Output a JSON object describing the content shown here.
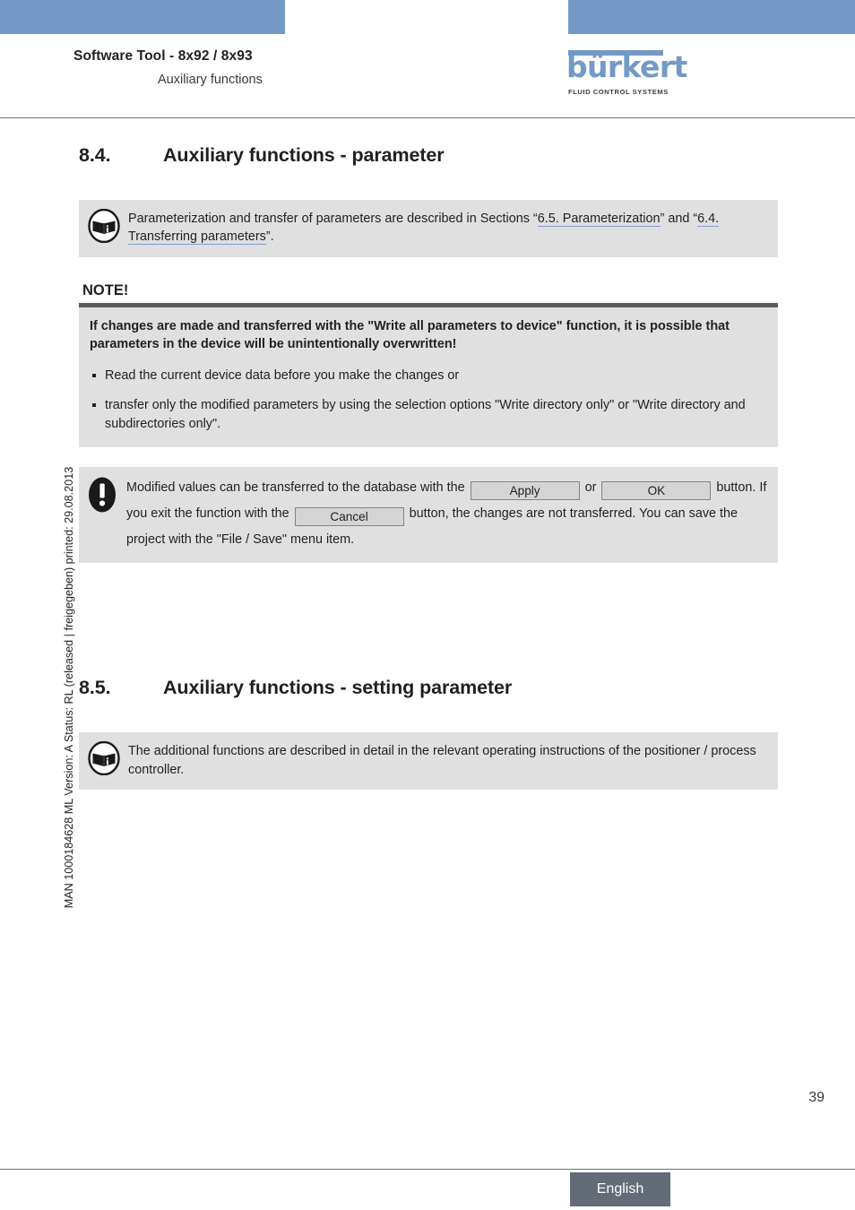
{
  "header": {
    "title": "Software Tool - 8x92 / 8x93",
    "subtitle": "Auxiliary functions",
    "logo_word": "bürkert",
    "logo_tagline": "FLUID CONTROL SYSTEMS"
  },
  "side_imprint": "MAN 1000184628  ML  Version: A  Status: RL (released | freigegeben)  printed: 29.08.2013",
  "sections": {
    "s84": {
      "number": "8.4.",
      "title": "Auxiliary functions - parameter"
    },
    "s85": {
      "number": "8.5.",
      "title": "Auxiliary functions - setting parameter"
    }
  },
  "info_box_1": {
    "icon": "manual-icon",
    "text_part_1": "Parameterization and transfer of parameters are described in Sections “",
    "link_1": "6.5. Parameterization",
    "text_part_2": "” and “",
    "link_2a": "6.4. ",
    "link_2b": "Transferring parameters",
    "text_part_3": "”."
  },
  "note": {
    "label": "NOTE!",
    "lead": "If changes are made and transferred with the \"Write all parameters to device\" function, it is possible that parameters in the device will be unintentionally overwritten!",
    "items": [
      "Read the current device data before you make the changes or",
      "transfer only the modified parameters by using the selection options \"Write directory only\" or \"Write directory and subdirectories only\"."
    ]
  },
  "warning_box": {
    "icon": "warning-icon",
    "text_1": "Modified values can be transferred to the database with the",
    "button_apply": "Apply",
    "text_or": "or",
    "button_ok": "OK",
    "text_2": "button. If you exit the function with the",
    "button_cancel": "Cancel",
    "text_3": "button, the changes are not transferred.",
    "text_4": "You can save the project with the \"File / Save\" menu item."
  },
  "info_box_2": {
    "icon": "manual-icon",
    "text": "The additional functions are described in detail in the relevant operating instructions of the positioner / process controller."
  },
  "footer": {
    "page_number": "39",
    "language": "English"
  },
  "colors": {
    "accent_blue": "#7399c6",
    "box_grey": "#e0e0e0",
    "note_bar": "#5c5c5c",
    "footer_grey": "#636b76",
    "link_underline": "#7f9fce"
  }
}
